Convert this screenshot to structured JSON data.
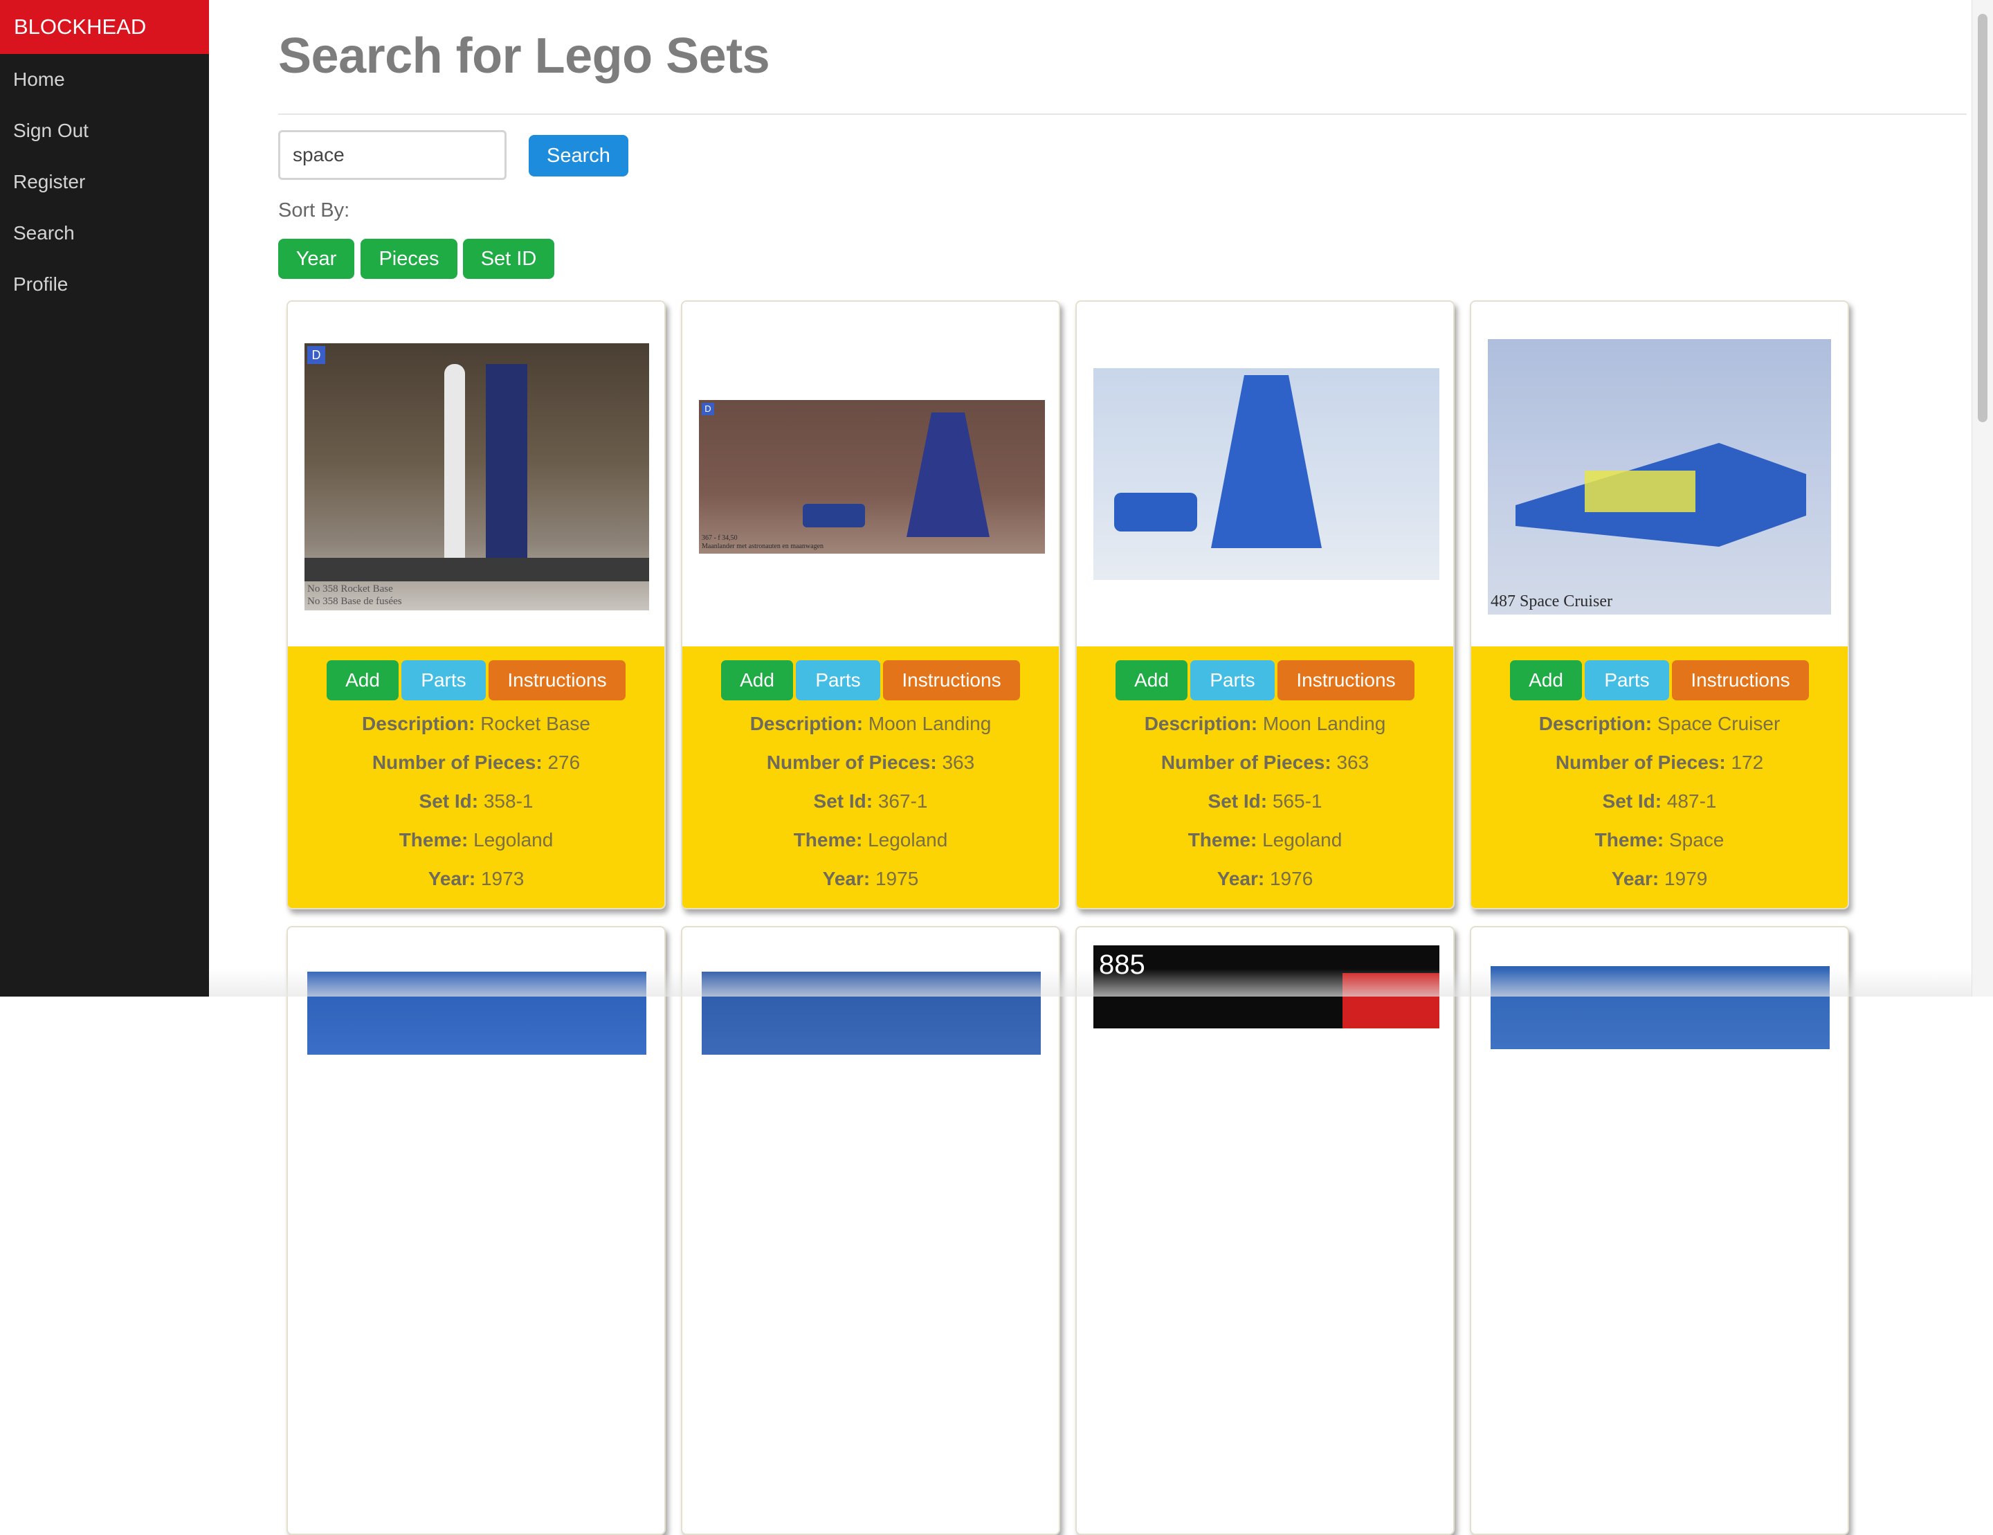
{
  "sidebar": {
    "brand": "BLOCKHEAD",
    "items": [
      {
        "label": "Home"
      },
      {
        "label": "Sign Out"
      },
      {
        "label": "Register"
      },
      {
        "label": "Search"
      },
      {
        "label": "Profile"
      }
    ]
  },
  "page": {
    "title": "Search for Lego Sets"
  },
  "search": {
    "value": "space",
    "button_label": "Search"
  },
  "sort": {
    "label": "Sort By:",
    "buttons": [
      "Year",
      "Pieces",
      "Set ID"
    ]
  },
  "card_actions": {
    "add": "Add",
    "parts": "Parts",
    "instructions": "Instructions"
  },
  "field_labels": {
    "description": "Description:",
    "pieces": "Number of Pieces:",
    "set_id": "Set Id:",
    "theme": "Theme:",
    "year": "Year:"
  },
  "results": [
    {
      "description": "Rocket Base",
      "pieces": "276",
      "set_id": "358-1",
      "theme": "Legoland",
      "year": "1973",
      "image_caption": "No 358 Rocket Base\nNo 358 Base de fusées",
      "badge": "D"
    },
    {
      "description": "Moon Landing",
      "pieces": "363",
      "set_id": "367-1",
      "theme": "Legoland",
      "year": "1975",
      "image_caption": "367 - f 34,50\nMaanlander met astronauten en maanwagen",
      "badge": "D"
    },
    {
      "description": "Moon Landing",
      "pieces": "363",
      "set_id": "565-1",
      "theme": "Legoland",
      "year": "1976"
    },
    {
      "description": "Space Cruiser",
      "pieces": "172",
      "set_id": "487-1",
      "theme": "Space",
      "year": "1979",
      "image_caption": "487 Space Cruiser"
    },
    {
      "image_caption": ""
    },
    {
      "image_caption": ""
    },
    {
      "image_caption": "885"
    },
    {
      "image_caption": ""
    }
  ],
  "colors": {
    "brand_red": "#d9141e",
    "sidebar_bg": "#1b1b1b",
    "card_info_bg": "#fcd303",
    "btn_green": "#1fac45",
    "btn_blue": "#1e8cdc",
    "btn_cyan": "#43bde3",
    "btn_orange": "#e4741a"
  }
}
